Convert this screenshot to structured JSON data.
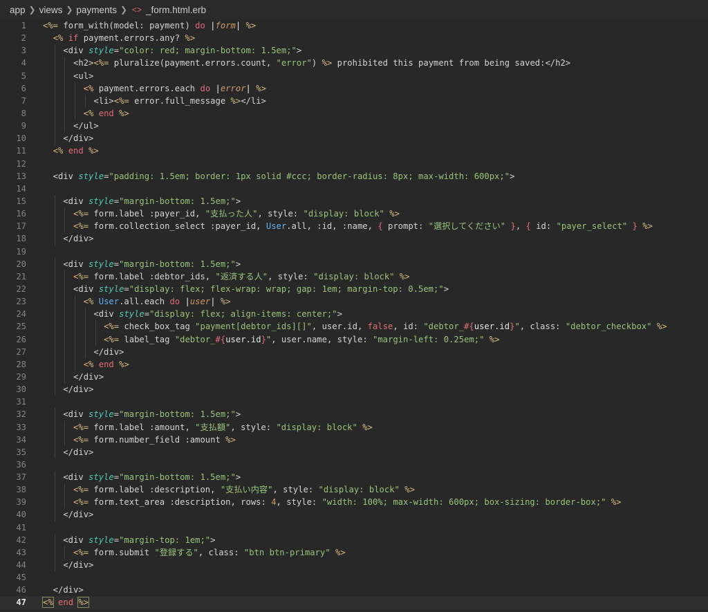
{
  "breadcrumb": {
    "segments": [
      "app",
      "views",
      "payments"
    ],
    "file_icon": "<>",
    "file_name": "_form.html.erb"
  },
  "editor": {
    "current_line": 47,
    "lines": [
      {
        "n": "1",
        "text": "<%= form_with(model: payment) do |form| %>"
      },
      {
        "n": "2",
        "text": "  <% if payment.errors.any? %>"
      },
      {
        "n": "3",
        "text": "    <div style=\"color: red; margin-bottom: 1.5em;\">"
      },
      {
        "n": "4",
        "text": "      <h2><%= pluralize(payment.errors.count, \"error\") %> prohibited this payment from being saved:</h2>"
      },
      {
        "n": "5",
        "text": "      <ul>"
      },
      {
        "n": "6",
        "text": "        <% payment.errors.each do |error| %>"
      },
      {
        "n": "7",
        "text": "          <li><%= error.full_message %></li>"
      },
      {
        "n": "8",
        "text": "        <% end %>"
      },
      {
        "n": "9",
        "text": "      </ul>"
      },
      {
        "n": "10",
        "text": "    </div>"
      },
      {
        "n": "11",
        "text": "  <% end %>"
      },
      {
        "n": "12",
        "text": ""
      },
      {
        "n": "13",
        "text": "  <div style=\"padding: 1.5em; border: 1px solid #ccc; border-radius: 8px; max-width: 600px;\">"
      },
      {
        "n": "14",
        "text": ""
      },
      {
        "n": "15",
        "text": "    <div style=\"margin-bottom: 1.5em;\">"
      },
      {
        "n": "16",
        "text": "      <%= form.label :payer_id, \"支払った人\", style: \"display: block\" %>"
      },
      {
        "n": "17",
        "text": "      <%= form.collection_select :payer_id, User.all, :id, :name, { prompt: \"選択してください\" }, { id: \"payer_select\" } %>"
      },
      {
        "n": "18",
        "text": "    </div>"
      },
      {
        "n": "19",
        "text": ""
      },
      {
        "n": "20",
        "text": "    <div style=\"margin-bottom: 1.5em;\">"
      },
      {
        "n": "21",
        "text": "      <%= form.label :debtor_ids, \"返済する人\", style: \"display: block\" %>"
      },
      {
        "n": "22",
        "text": "      <div style=\"display: flex; flex-wrap: wrap; gap: 1em; margin-top: 0.5em;\">"
      },
      {
        "n": "23",
        "text": "        <% User.all.each do |user| %>"
      },
      {
        "n": "24",
        "text": "          <div style=\"display: flex; align-items: center;\">"
      },
      {
        "n": "25",
        "text": "            <%= check_box_tag \"payment[debtor_ids][]\", user.id, false, id: \"debtor_#{user.id}\", class: \"debtor_checkbox\" %>"
      },
      {
        "n": "26",
        "text": "            <%= label_tag \"debtor_#{user.id}\", user.name, style: \"margin-left: 0.25em;\" %>"
      },
      {
        "n": "27",
        "text": "          </div>"
      },
      {
        "n": "28",
        "text": "        <% end %>"
      },
      {
        "n": "29",
        "text": "      </div>"
      },
      {
        "n": "30",
        "text": "    </div>"
      },
      {
        "n": "31",
        "text": ""
      },
      {
        "n": "32",
        "text": "    <div style=\"margin-bottom: 1.5em;\">"
      },
      {
        "n": "33",
        "text": "      <%= form.label :amount, \"支払額\", style: \"display: block\" %>"
      },
      {
        "n": "34",
        "text": "      <%= form.number_field :amount %>"
      },
      {
        "n": "35",
        "text": "    </div>"
      },
      {
        "n": "36",
        "text": ""
      },
      {
        "n": "37",
        "text": "    <div style=\"margin-bottom: 1.5em;\">"
      },
      {
        "n": "38",
        "text": "      <%= form.label :description, \"支払い内容\", style: \"display: block\" %>"
      },
      {
        "n": "39",
        "text": "      <%= form.text_area :description, rows: 4, style: \"width: 100%; max-width: 600px; box-sizing: border-box;\" %>"
      },
      {
        "n": "40",
        "text": "    </div>"
      },
      {
        "n": "41",
        "text": ""
      },
      {
        "n": "42",
        "text": "    <div style=\"margin-top: 1em;\">"
      },
      {
        "n": "43",
        "text": "      <%= form.submit \"登録する\", class: \"btn btn-primary\" %>"
      },
      {
        "n": "44",
        "text": "    </div>"
      },
      {
        "n": "45",
        "text": ""
      },
      {
        "n": "46",
        "text": "  </div>"
      },
      {
        "n": "47",
        "text": "<% end %>"
      }
    ]
  }
}
